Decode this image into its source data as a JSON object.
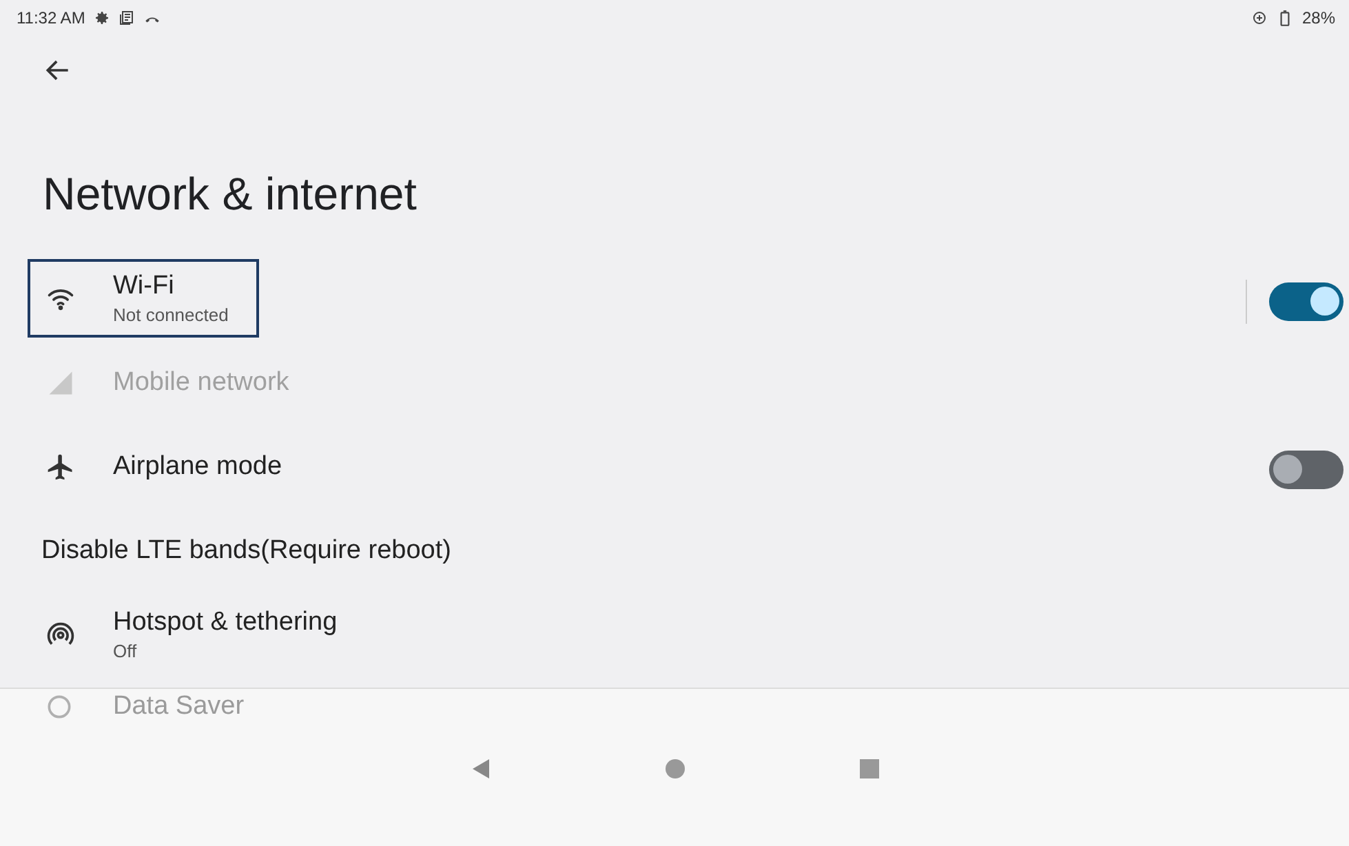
{
  "status_bar": {
    "time": "11:32 AM",
    "battery": "28%"
  },
  "title": "Network & internet",
  "items": [
    {
      "kind": "wifi",
      "title": "Wi-Fi",
      "subtitle": "Not connected",
      "focused": true,
      "disabled": false,
      "toggle": {
        "on": true,
        "divider": true
      }
    },
    {
      "kind": "signal",
      "title": "Mobile network",
      "focused": false,
      "disabled": true
    },
    {
      "kind": "airplane",
      "title": "Airplane mode",
      "focused": false,
      "disabled": false,
      "toggle": {
        "on": false,
        "divider": false
      }
    },
    {
      "kind": "none",
      "title": "Disable LTE bands(Require reboot)",
      "focused": false,
      "disabled": false
    },
    {
      "kind": "hotspot",
      "title": "Hotspot & tethering",
      "subtitle": "Off",
      "focused": false,
      "disabled": false
    }
  ],
  "behind_nav": {
    "title": "Data Saver"
  }
}
